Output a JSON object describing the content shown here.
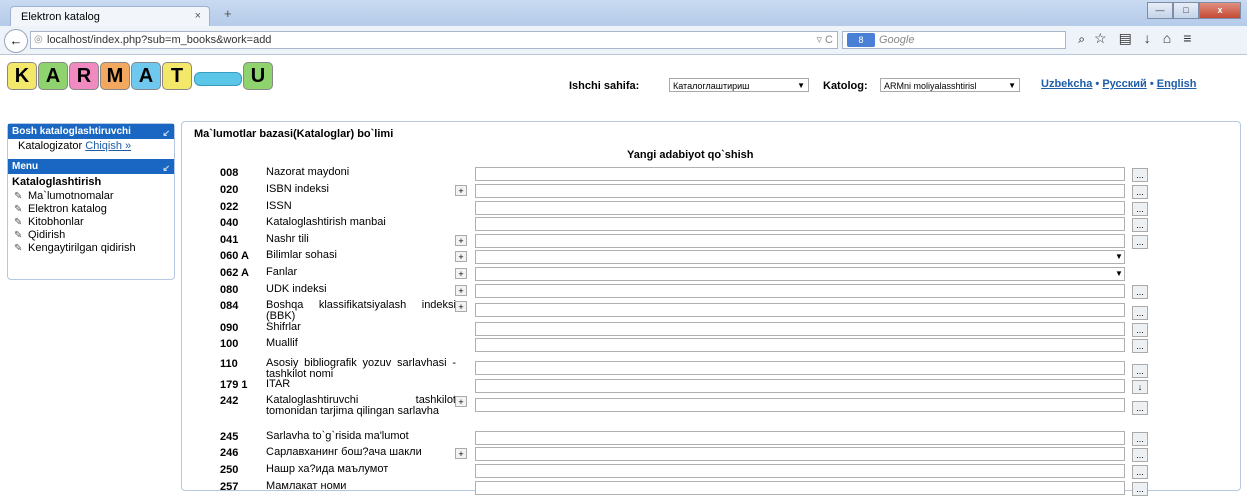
{
  "browser": {
    "tab_title": "Elektron katalog",
    "tab_close": "×",
    "new_tab": "+",
    "url": "localhost/index.php?sub=m_books&work=add",
    "search_placeholder": "Google",
    "search_engine_label": "8",
    "min_label": "—",
    "max_label": "□",
    "close_label": "x"
  },
  "header": {
    "logo_letters": [
      "K",
      "A",
      "R",
      "M",
      "A",
      "T",
      "U"
    ],
    "ishchi_label": "Ishchi sahifa:",
    "ishchi_value": "Каталоглаштириш",
    "katolog_label": "Katolog:",
    "katolog_value": "ARMni moliyalasshtirisl",
    "lang_uz": "Uzbekcha",
    "lang_ru": "Русский",
    "lang_en": "English",
    "lang_sep": "•"
  },
  "sidebar": {
    "section1_title": "Bosh kataloglashtiruvchi",
    "user_label": "Katalogizator",
    "exit_link": "Chiqish »",
    "menu_title": "Menu",
    "group_title": "Kataloglashtirish",
    "items": [
      {
        "label": "Ma`lumotnomalar"
      },
      {
        "label": "Elektron katalog"
      },
      {
        "label": "Kitobhonlar"
      },
      {
        "label": "Qidirish"
      },
      {
        "label": "Kengaytirilgan qidirish"
      }
    ]
  },
  "main": {
    "title": "Ma`lumotlar bazasi(Kataloglar) bo`limi",
    "form_title": "Yangi adabiyot qo`shish",
    "fields": [
      {
        "code": "008",
        "label": "Nazorat maydoni",
        "plus": false,
        "type": "text"
      },
      {
        "code": "020",
        "label": "ISBN indeksi",
        "plus": true,
        "type": "text"
      },
      {
        "code": "022",
        "label": "ISSN",
        "plus": false,
        "type": "text"
      },
      {
        "code": "040",
        "label": "Kataloglashtirish manbai",
        "plus": false,
        "type": "text"
      },
      {
        "code": "041",
        "label": "Nashr tili",
        "plus": true,
        "type": "text"
      },
      {
        "code": "060 A",
        "label": "Bilimlar sohasi",
        "plus": true,
        "type": "select"
      },
      {
        "code": "062 A",
        "label": "Fanlar",
        "plus": true,
        "type": "select"
      },
      {
        "code": "080",
        "label": "UDK indeksi",
        "plus": true,
        "type": "text"
      },
      {
        "code": "084",
        "label": "Boshqa klassifikatsiyalash indeksi (BBK)",
        "plus": true,
        "type": "text"
      },
      {
        "code": "090",
        "label": "Shifrlar",
        "plus": false,
        "type": "text"
      },
      {
        "code": "100",
        "label": "Muallif",
        "plus": false,
        "type": "text"
      },
      {
        "code": "110",
        "label": "Asosiy bibliografik yozuv sarlavhasi - tashkilot nomi",
        "plus": false,
        "type": "text"
      },
      {
        "code": "179 1",
        "label": "ITAR",
        "plus": false,
        "type": "text-down"
      },
      {
        "code": "242",
        "label": "Kataloglashtiruvchi tashkilot tomonidan tarjima qilingan sarlavha",
        "plus": true,
        "type": "text"
      },
      {
        "code": "245",
        "label": "Sarlavha to`g`risida ma'lumot",
        "plus": false,
        "type": "text"
      },
      {
        "code": "246",
        "label": "Сарлавханинг бош?ача шакли",
        "plus": true,
        "type": "text"
      },
      {
        "code": "250",
        "label": "Нашр ха?ида маълумот",
        "plus": false,
        "type": "text"
      },
      {
        "code": "257",
        "label": "Мамлакат номи",
        "plus": false,
        "type": "text"
      }
    ],
    "plus_label": "+",
    "dots_label": "...",
    "down_label": "↓"
  }
}
